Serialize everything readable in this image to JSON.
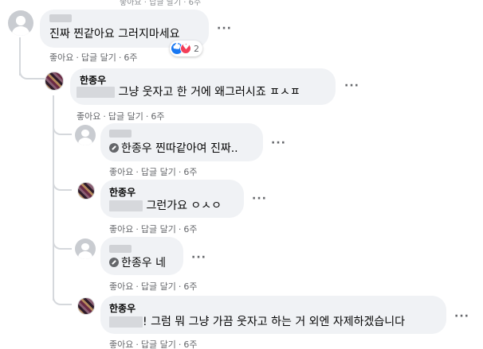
{
  "top_actions": "좋아요 · 답글 달기 · 6주",
  "comments": [
    {
      "author": "",
      "text": "진짜 찐같아요 그러지마세요",
      "like_label": "좋아요",
      "reply_label": "답글 달기",
      "time": "6주",
      "reaction_count": "2"
    },
    {
      "author": "한종우",
      "text": "그냥 웃자고 한 거에 왜그러시죠 ㅍㅅㅍ",
      "like_label": "좋아요",
      "reply_label": "답글 달기",
      "time": "6주"
    }
  ],
  "replies": [
    {
      "author": "",
      "mention": "한종우",
      "text": "찐따같아여 진짜..",
      "like_label": "좋아요",
      "reply_label": "답글 달기",
      "time": "6주"
    },
    {
      "author": "한종우",
      "text": "그런가요 ㅇㅅㅇ",
      "like_label": "좋아요",
      "reply_label": "답글 달기",
      "time": "6주"
    },
    {
      "author": "",
      "mention": "한종우",
      "text": "네",
      "like_label": "좋아요",
      "reply_label": "답글 달기",
      "time": "6주"
    },
    {
      "author": "한종우",
      "text": "! 그럼 뭐 그냥 가끔 웃자고 하는 거 외엔 자제하겠습니다",
      "like_label": "좋아요",
      "reply_label": "답글 달기",
      "time": "6주"
    }
  ],
  "more_label": "···",
  "icons": {
    "default_avatar": "default-avatar-icon",
    "profile_photo": "profile-photo",
    "like_reaction": "like-reaction-icon",
    "love_reaction": "love-reaction-icon",
    "mention": "mention-tag-icon",
    "more": "more-options-icon"
  },
  "colors": {
    "bubble": "#f0f2f5",
    "meta_text": "#65676b",
    "like_blue": "#1877f2",
    "love_red": "#f33e58"
  }
}
